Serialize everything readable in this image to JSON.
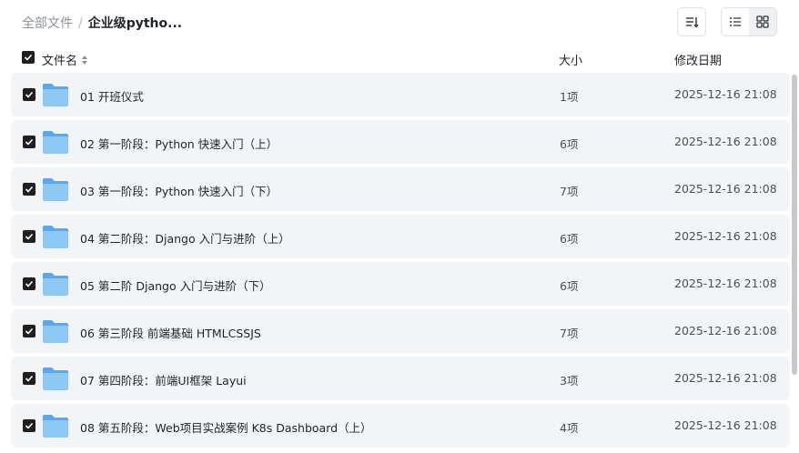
{
  "breadcrumb": {
    "root": "全部文件",
    "separator": "/",
    "current": "企业级pytho..."
  },
  "toolbar": {
    "sort_icon": "sort-lines-icon",
    "list_view_icon": "list-view-icon",
    "grid_view_icon": "grid-view-icon",
    "active_view": "list"
  },
  "columns": {
    "name": "文件名",
    "size": "大小",
    "modified": "修改日期"
  },
  "colors": {
    "checkbox": "#1f1f1f",
    "row_bg": "#f3f4f6",
    "folder_body": "#8ec8f5",
    "folder_tab": "#5aa9ee"
  },
  "files": [
    {
      "name": "01 开班仪式",
      "size": "1项",
      "modified": "2025-12-16 21:08",
      "checked": true
    },
    {
      "name": "02 第一阶段：Python 快速入门（上）",
      "size": "6项",
      "modified": "2025-12-16 21:08",
      "checked": true
    },
    {
      "name": "03 第一阶段：Python 快速入门（下）",
      "size": "7项",
      "modified": "2025-12-16 21:08",
      "checked": true
    },
    {
      "name": "04 第二阶段：Django 入门与进阶（上）",
      "size": "6项",
      "modified": "2025-12-16 21:08",
      "checked": true
    },
    {
      "name": "05 第二阶 Django 入门与进阶（下）",
      "size": "6项",
      "modified": "2025-12-16 21:08",
      "checked": true
    },
    {
      "name": "06 第三阶段 前端基础 HTMLCSSJS",
      "size": "7项",
      "modified": "2025-12-16 21:08",
      "checked": true
    },
    {
      "name": "07 第四阶段：前端UI框架 Layui",
      "size": "3项",
      "modified": "2025-12-16 21:08",
      "checked": true
    },
    {
      "name": "08 第五阶段：Web项目实战案例 K8s Dashboard（上）",
      "size": "4项",
      "modified": "2025-12-16 21:08",
      "checked": true
    }
  ]
}
